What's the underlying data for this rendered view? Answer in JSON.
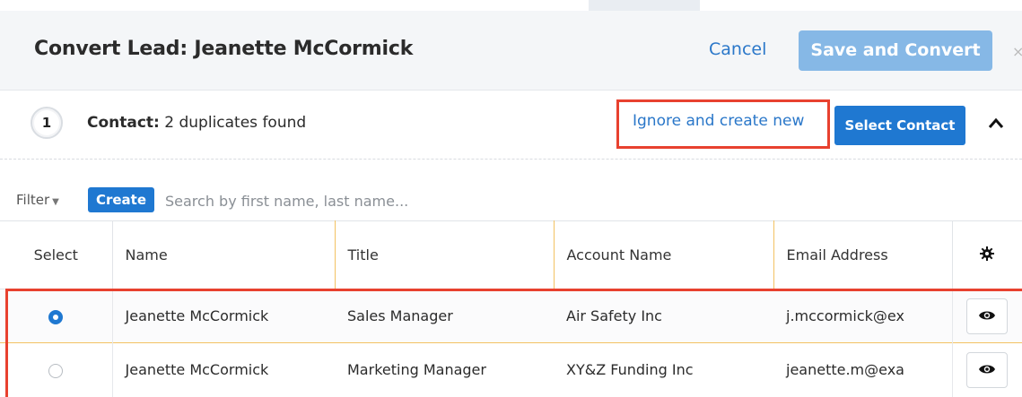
{
  "header": {
    "title": "Convert Lead: Jeanette McCormick",
    "cancel_label": "Cancel",
    "save_label": "Save and Convert"
  },
  "contact_step": {
    "number": "1",
    "label": "Contact:",
    "status": "2 duplicates found",
    "ignore_label": "Ignore and create new",
    "select_label": "Select Contact"
  },
  "filter_bar": {
    "filter_label": "Filter",
    "create_label": "Create",
    "search_placeholder": "Search by first name, last name..."
  },
  "table": {
    "columns": [
      "Select",
      "Name",
      "Title",
      "Account Name",
      "Email Address"
    ],
    "rows": [
      {
        "selected": true,
        "name": "Jeanette McCormick",
        "title": "Sales Manager",
        "account": "Air Safety Inc",
        "email": "j.mccormick@ex"
      },
      {
        "selected": false,
        "name": "Jeanette McCormick",
        "title": "Marketing Manager",
        "account": "XY&Z Funding Inc",
        "email": "jeanette.m@exa"
      }
    ]
  },
  "colors": {
    "accent": "#1f78d1",
    "highlight": "#e8412f"
  }
}
